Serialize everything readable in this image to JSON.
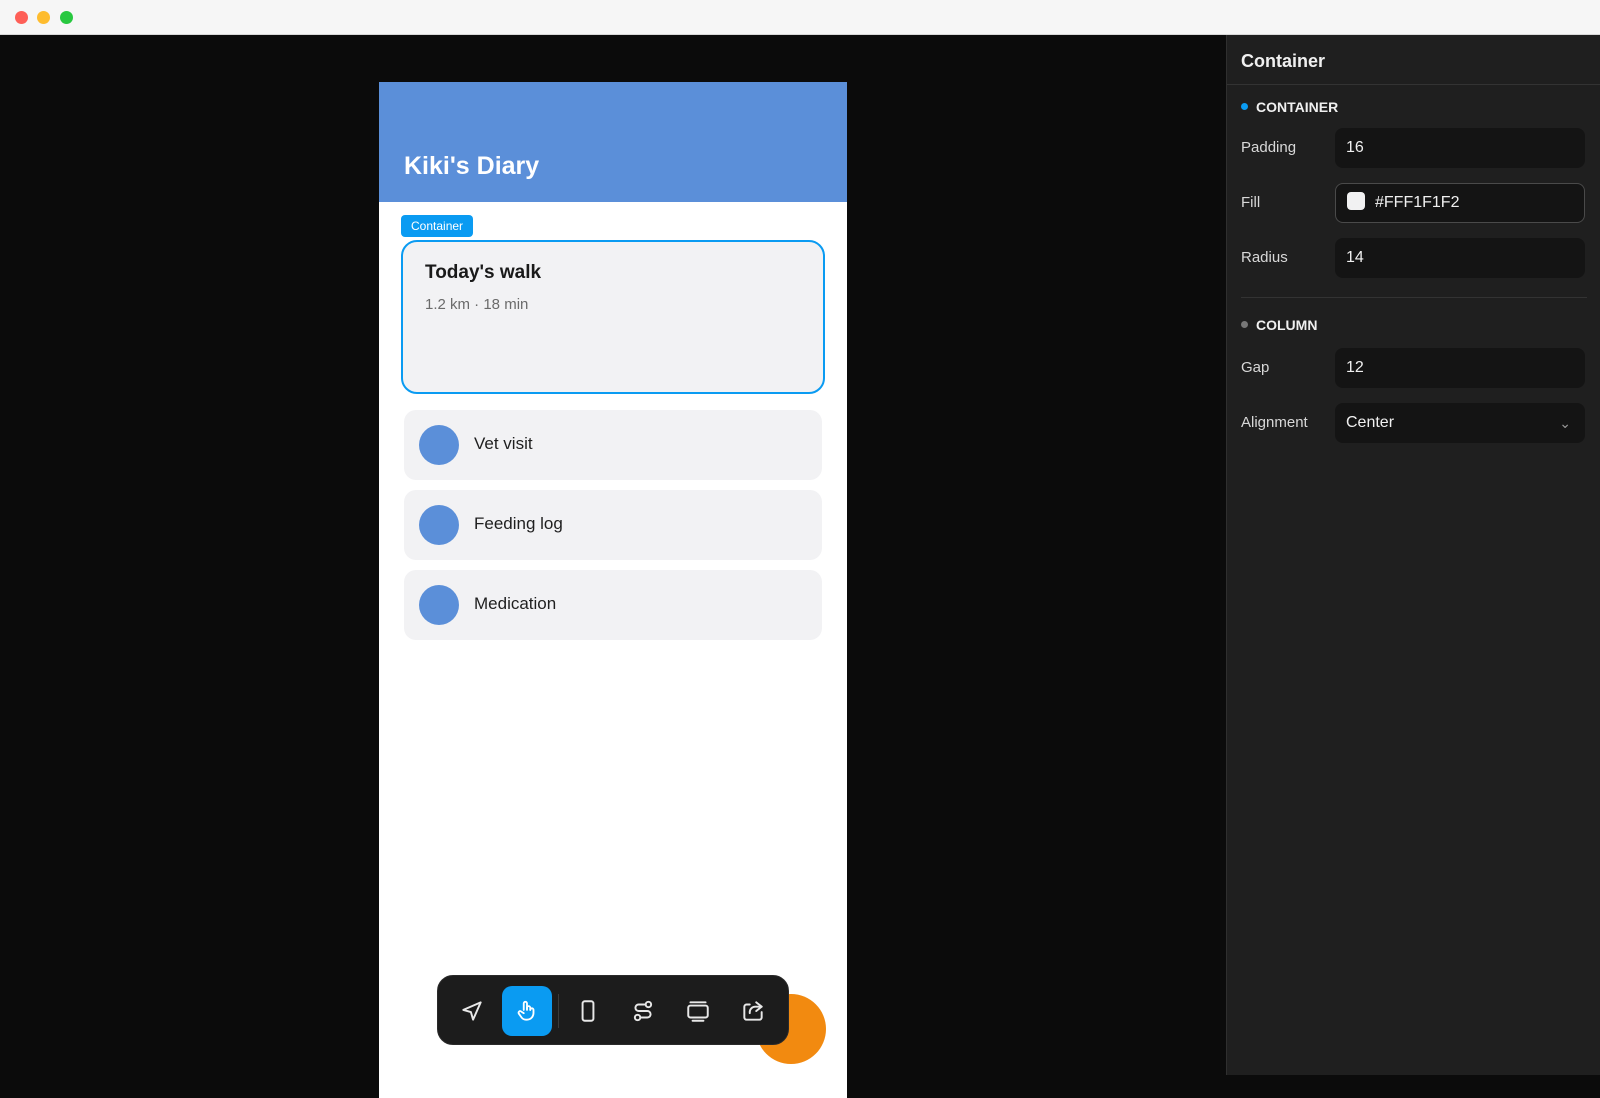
{
  "window": {
    "controls": [
      "close",
      "minimize",
      "maximize"
    ]
  },
  "app": {
    "title": "Kiki's Diary",
    "selection_tag": "Container",
    "walk_card": {
      "title": "Today's walk",
      "subtitle": "1.2 km · 18 min"
    },
    "items": [
      {
        "label": "Vet visit"
      },
      {
        "label": "Feeding log"
      },
      {
        "label": "Medication"
      }
    ],
    "colors": {
      "header": "#5b8fd9",
      "accent": "#0a9bf2",
      "fab": "#f28a10"
    }
  },
  "toolbar": {
    "tools": [
      {
        "icon": "navigation-arrow-icon",
        "active": false
      },
      {
        "icon": "hand-pointer-icon",
        "active": true
      },
      {
        "icon": "phone-frame-icon",
        "active": false
      },
      {
        "icon": "flow-connect-icon",
        "active": false
      },
      {
        "icon": "stack-layers-icon",
        "active": false
      },
      {
        "icon": "share-icon",
        "active": false
      }
    ]
  },
  "inspector": {
    "title": "Container",
    "container_section": {
      "heading": "CONTAINER",
      "padding": {
        "label": "Padding",
        "value": "16"
      },
      "fill": {
        "label": "Fill",
        "value": "#FFF1F1F2"
      },
      "radius": {
        "label": "Radius",
        "value": "14"
      }
    },
    "column_section": {
      "heading": "COLUMN",
      "gap": {
        "label": "Gap",
        "value": "12"
      },
      "alignment": {
        "label": "Alignment",
        "value": "Center"
      }
    }
  }
}
